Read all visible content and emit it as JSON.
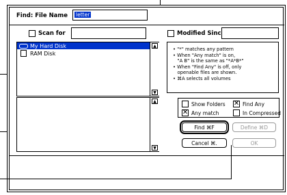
{
  "find": {
    "label": "Find: File Name",
    "value": "letter"
  },
  "scan_for": {
    "label": "Scan for",
    "value": ""
  },
  "modified_since": {
    "label": "Modified Since",
    "value": ""
  },
  "volumes": [
    {
      "label": "My Hard Disk",
      "icon": "hard-disk-icon"
    },
    {
      "label": "RAM Disk",
      "icon": "ram-disk-icon"
    }
  ],
  "help_lines": [
    "• \"*\" matches any pattern",
    "• When \"Any match\" is on,",
    "   \"A B\" is the same as \"*A*B*\"",
    "• When \"Find Any\" is off, only",
    "   openable files are shown.",
    "• ⌘A selects all volumes"
  ],
  "options": {
    "show_folders": {
      "label": "Show Folders",
      "checked": false
    },
    "find_any": {
      "label": "Find Any",
      "checked": true
    },
    "any_match": {
      "label": "Any match",
      "checked": true
    },
    "in_compressed": {
      "label": "In Compressed",
      "checked": false
    }
  },
  "buttons": {
    "find": "Find ⌘F",
    "define": "Define ⌘D",
    "cancel": "Cancel ⌘.",
    "ok": "OK"
  }
}
